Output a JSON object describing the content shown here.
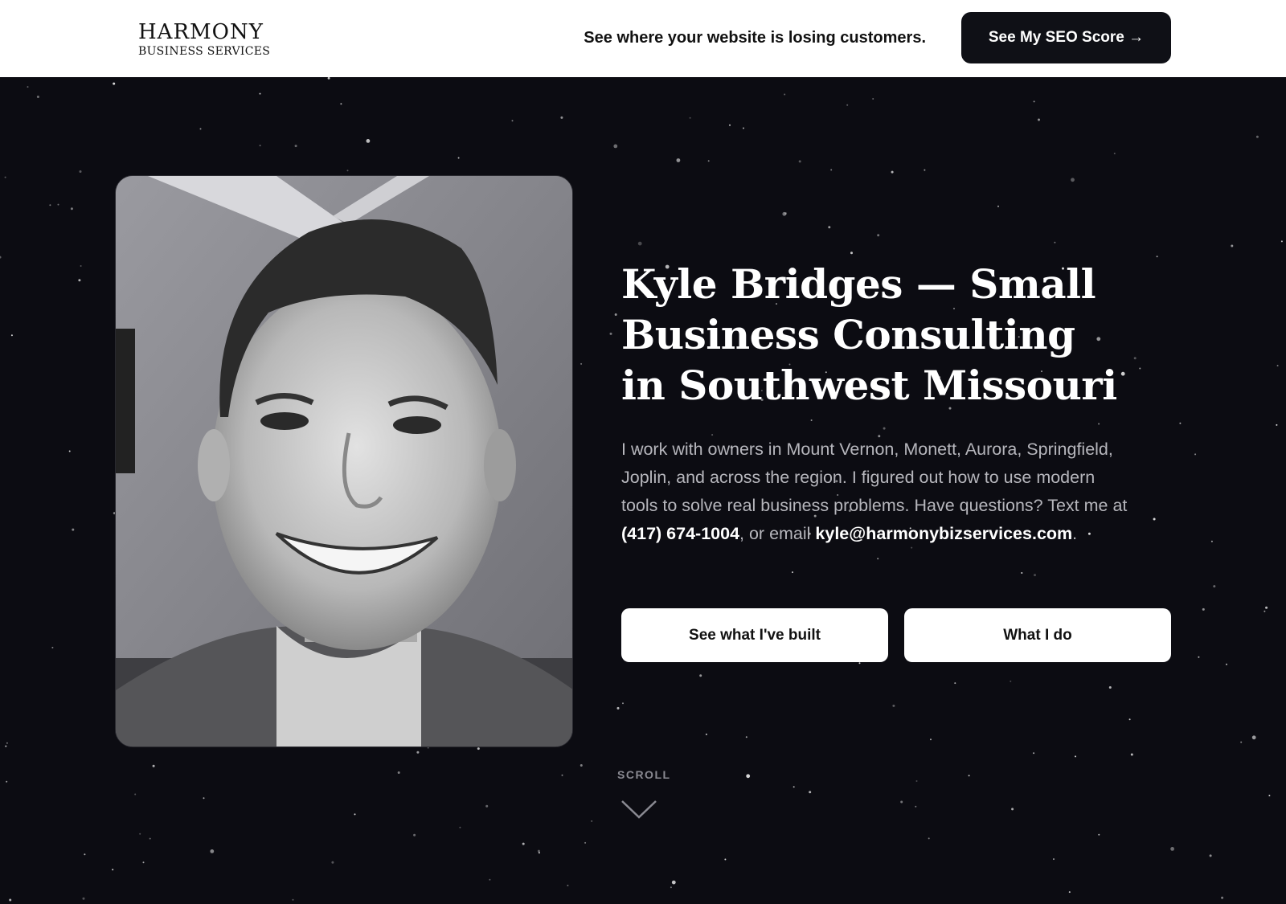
{
  "header": {
    "logo_word": "HARMONY",
    "logo_sub": "BUSINESS SERVICES",
    "tagline": "See where your website is losing customers.",
    "cta_label": "See My SEO Score →"
  },
  "hero": {
    "portrait_alt": "Portrait of Kyle Bridges",
    "headline": "Kyle Bridges — Small Business Consulting in Southwest Missouri",
    "desc_before_phone": "I work with owners in Mount Vernon, Monett, Aurora, Springfield, Joplin, and across the region. I figured out how to use modern tools to solve real business problems. Have questions? Text me at ",
    "phone": "(417) 674-1004",
    "desc_between": ", or email ",
    "email": "kyle@harmonybizservices.com",
    "desc_after": ".",
    "button_primary": "See what I've built",
    "button_secondary": "What I do",
    "scroll_label": "SCROLL"
  },
  "colors": {
    "background": "#0c0c12",
    "header_bg": "#ffffff",
    "cta_bg": "#0f1016",
    "text_primary": "#ffffff",
    "text_muted": "#b6b6bc"
  }
}
